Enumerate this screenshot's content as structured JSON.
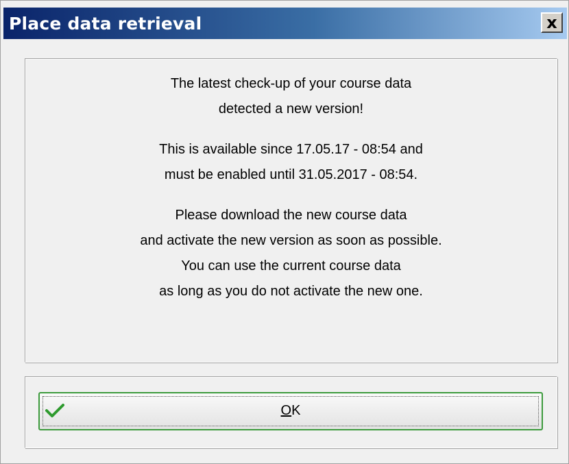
{
  "window": {
    "title": "Place data retrieval",
    "close_label": "x"
  },
  "message": {
    "lines": [
      "The latest check-up of your course data",
      "detected a new version!",
      "This is available since 17.05.17 - 08:54 and",
      "must be enabled until 31.05.2017 - 08:54.",
      "Please download the new course data",
      "and activate the new version as soon as possible.",
      "You can use the current course data",
      "as long as you do not activate the new one."
    ]
  },
  "buttons": {
    "ok_mnemonic": "O",
    "ok_rest": "K",
    "ok_icon": "check-icon",
    "ok_icon_color": "#2e9a2e"
  },
  "colors": {
    "titlebar_start": "#0a246a",
    "titlebar_end": "#a6caf0",
    "dialog_bg": "#f0f0f0",
    "ok_border": "#3c9a3c"
  }
}
